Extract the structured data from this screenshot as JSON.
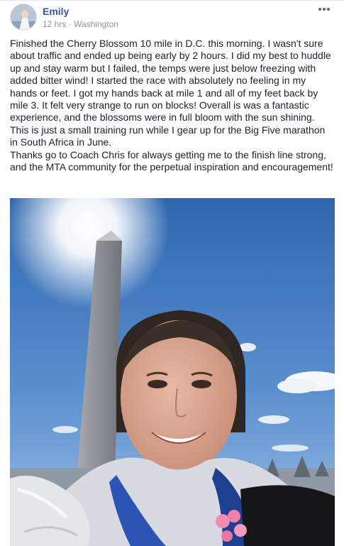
{
  "post": {
    "author": "Emily",
    "time": "12 hrs",
    "separator": "·",
    "location": "Washington",
    "more_icon": "more-horizontal-icon",
    "paragraph_1": "Finished the Cherry Blossom 10 mile in D.C. this morning. I wasn't sure about traffic and ended up being early by 2 hours. I did my best to huddle up and stay warm but I failed, the temps were just below freezing with added bitter wind! I started the race with absolutely no feeling in my hands or feet. I got my hands back at mile 1 and all of my feet back by mile 3. It felt very strange to run on blocks! Overall is was a fantastic experience, and the blossoms were in full bloom with the sun shining. This is just a small training run while I gear up for the Big Five marathon in South Africa in June.",
    "paragraph_2": "Thanks go to Coach Chris for always getting me to the finish line strong, and the MTA community for the perpetual inspiration and encouragement!"
  },
  "colors": {
    "name_link": "#365899",
    "meta_text": "#90949c",
    "body_text": "#1d2129",
    "sky": "#4f86c6"
  }
}
